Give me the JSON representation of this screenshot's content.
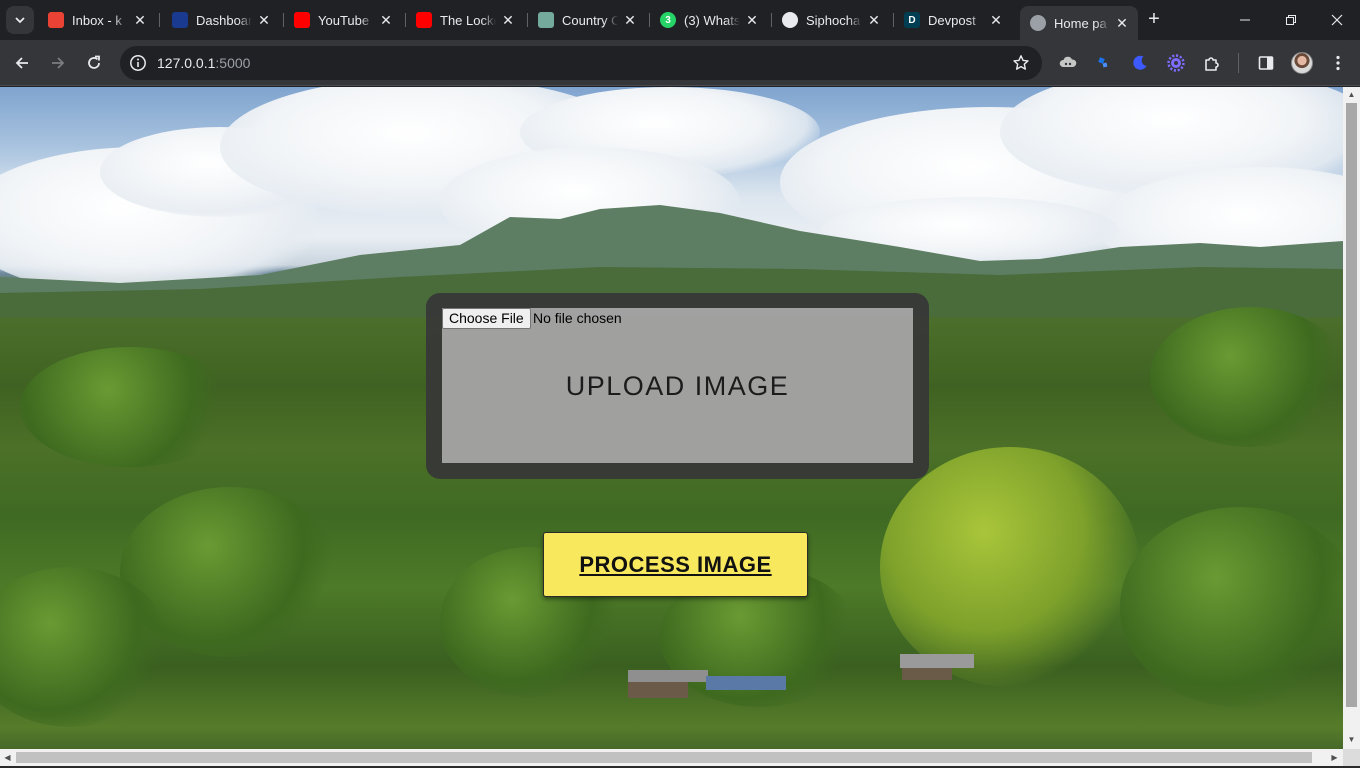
{
  "browser": {
    "tabs": [
      {
        "title": "Inbox - k",
        "favicon": "gmail-icon",
        "favicon_color": "#ea4335",
        "active": false
      },
      {
        "title": "Dashboard",
        "favicon": "dashboard-icon",
        "favicon_color": "#1a3a8f",
        "active": false
      },
      {
        "title": "YouTube",
        "favicon": "youtube-icon",
        "favicon_color": "#ff0000",
        "active": false
      },
      {
        "title": "The Lockd",
        "favicon": "youtube-icon",
        "favicon_color": "#ff0000",
        "active": false
      },
      {
        "title": "Country C",
        "favicon": "chatgpt-icon",
        "favicon_color": "#74aa9c",
        "active": false
      },
      {
        "title": "(3) Whats",
        "favicon": "whatsapp-icon",
        "favicon_color": "#25d366",
        "favicon_text": "3",
        "active": false
      },
      {
        "title": "Siphocha",
        "favicon": "github-icon",
        "favicon_color": "#e8eaed",
        "active": false
      },
      {
        "title": "Devpost",
        "favicon": "devpost-icon",
        "favicon_color": "#003e54",
        "favicon_text": "D",
        "active": false
      },
      {
        "title": "Home pa",
        "favicon": "globe-icon",
        "favicon_color": "#9aa0a6",
        "active": true
      }
    ],
    "address": {
      "host": "127.0.0.1",
      "port": ":5000"
    },
    "extensions": [
      "cloud-extension-icon",
      "bluesky-extension-icon",
      "moon-extension-icon",
      "gear-extension-icon",
      "puzzle-extensions-icon"
    ]
  },
  "page": {
    "file_input": {
      "button_label": "Choose File",
      "status": "No file chosen"
    },
    "upload_title": "UPLOAD IMAGE",
    "process_button": "PROCESS IMAGE",
    "colors": {
      "process_button": "#f7e85e",
      "upload_card": "#373737"
    }
  }
}
